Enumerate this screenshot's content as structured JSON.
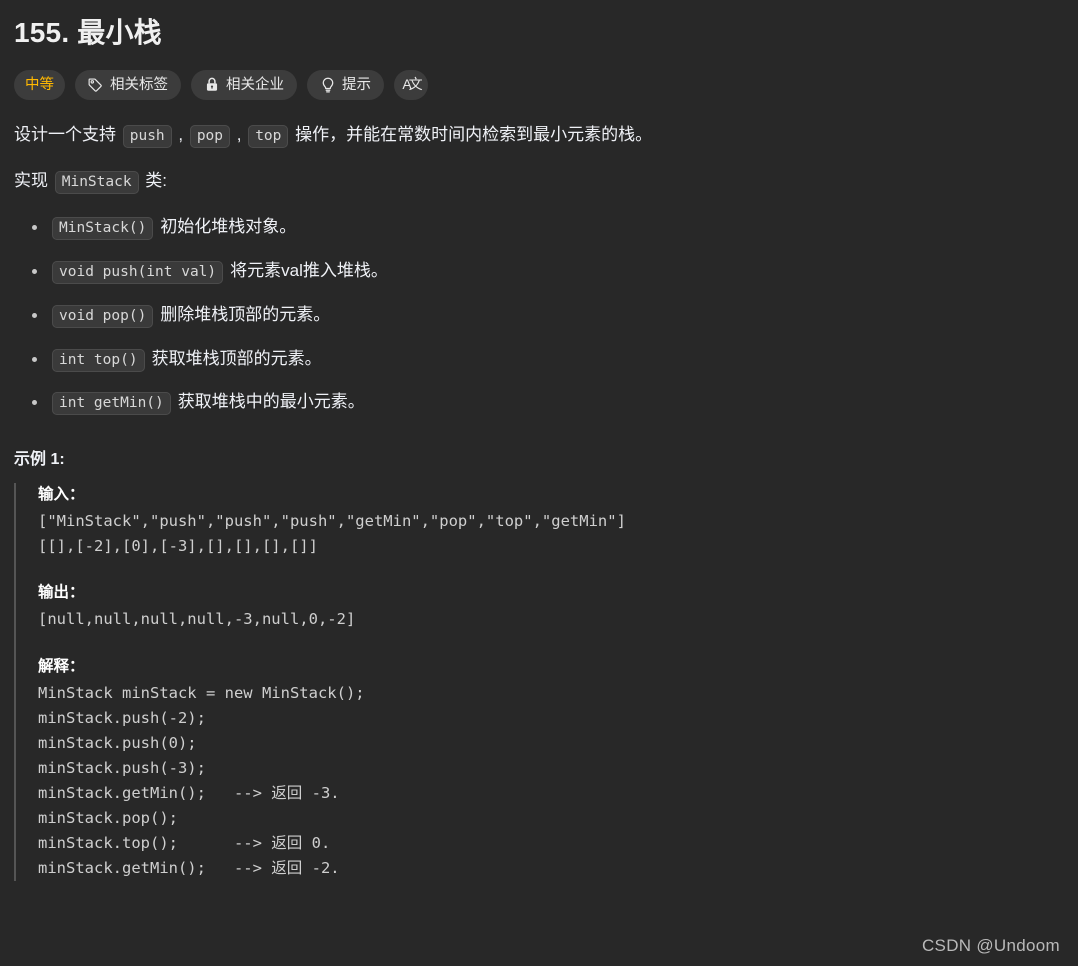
{
  "colors": {
    "background": "#282828",
    "text": "#eff1f6",
    "difficulty_accent": "#ffb800",
    "chip_background": "#3a3a3a",
    "badge_background": "#3c3c3c",
    "quote_border": "#555555",
    "watermark": "#b9b9b9"
  },
  "header": {
    "title": "155. 最小栈",
    "badges": [
      {
        "label": "中等",
        "icon": "none",
        "kind": "difficulty"
      },
      {
        "label": "相关标签",
        "icon": "tag-icon",
        "kind": "normal"
      },
      {
        "label": "相关企业",
        "icon": "lock-icon",
        "kind": "normal"
      },
      {
        "label": "提示",
        "icon": "lightbulb-icon",
        "kind": "normal"
      },
      {
        "label": "A文",
        "icon": "translate-icon",
        "kind": "icon-only"
      }
    ]
  },
  "description": {
    "line1": {
      "prefix": "设计一个支持 ",
      "code1": "push",
      "sep1": " , ",
      "code2": "pop",
      "sep2": " , ",
      "code3": "top",
      "suffix": " 操作，并能在常数时间内检索到最小元素的栈。"
    },
    "line2": {
      "prefix": "实现 ",
      "code": "MinStack",
      "suffix": " 类:"
    }
  },
  "spec_list": [
    {
      "code": "MinStack()",
      "desc": "初始化堆栈对象。"
    },
    {
      "code": "void push(int val)",
      "desc": "将元素val推入堆栈。"
    },
    {
      "code": "void pop()",
      "desc": "删除堆栈顶部的元素。"
    },
    {
      "code": "int top()",
      "desc": "获取堆栈顶部的元素。"
    },
    {
      "code": "int getMin()",
      "desc": "获取堆栈中的最小元素。"
    }
  ],
  "example": {
    "heading": "示例 1:",
    "input_label": "输入：",
    "input_code": "[\"MinStack\",\"push\",\"push\",\"push\",\"getMin\",\"pop\",\"top\",\"getMin\"]\n[[],[-2],[0],[-3],[],[],[],[]]",
    "output_label": "输出：",
    "output_code": "[null,null,null,null,-3,null,0,-2]",
    "explain_label": "解释：",
    "explain_code": "MinStack minStack = new MinStack();\nminStack.push(-2);\nminStack.push(0);\nminStack.push(-3);\nminStack.getMin();   --> 返回 -3.\nminStack.pop();\nminStack.top();      --> 返回 0.\nminStack.getMin();   --> 返回 -2."
  },
  "watermark": "CSDN @Undoom"
}
